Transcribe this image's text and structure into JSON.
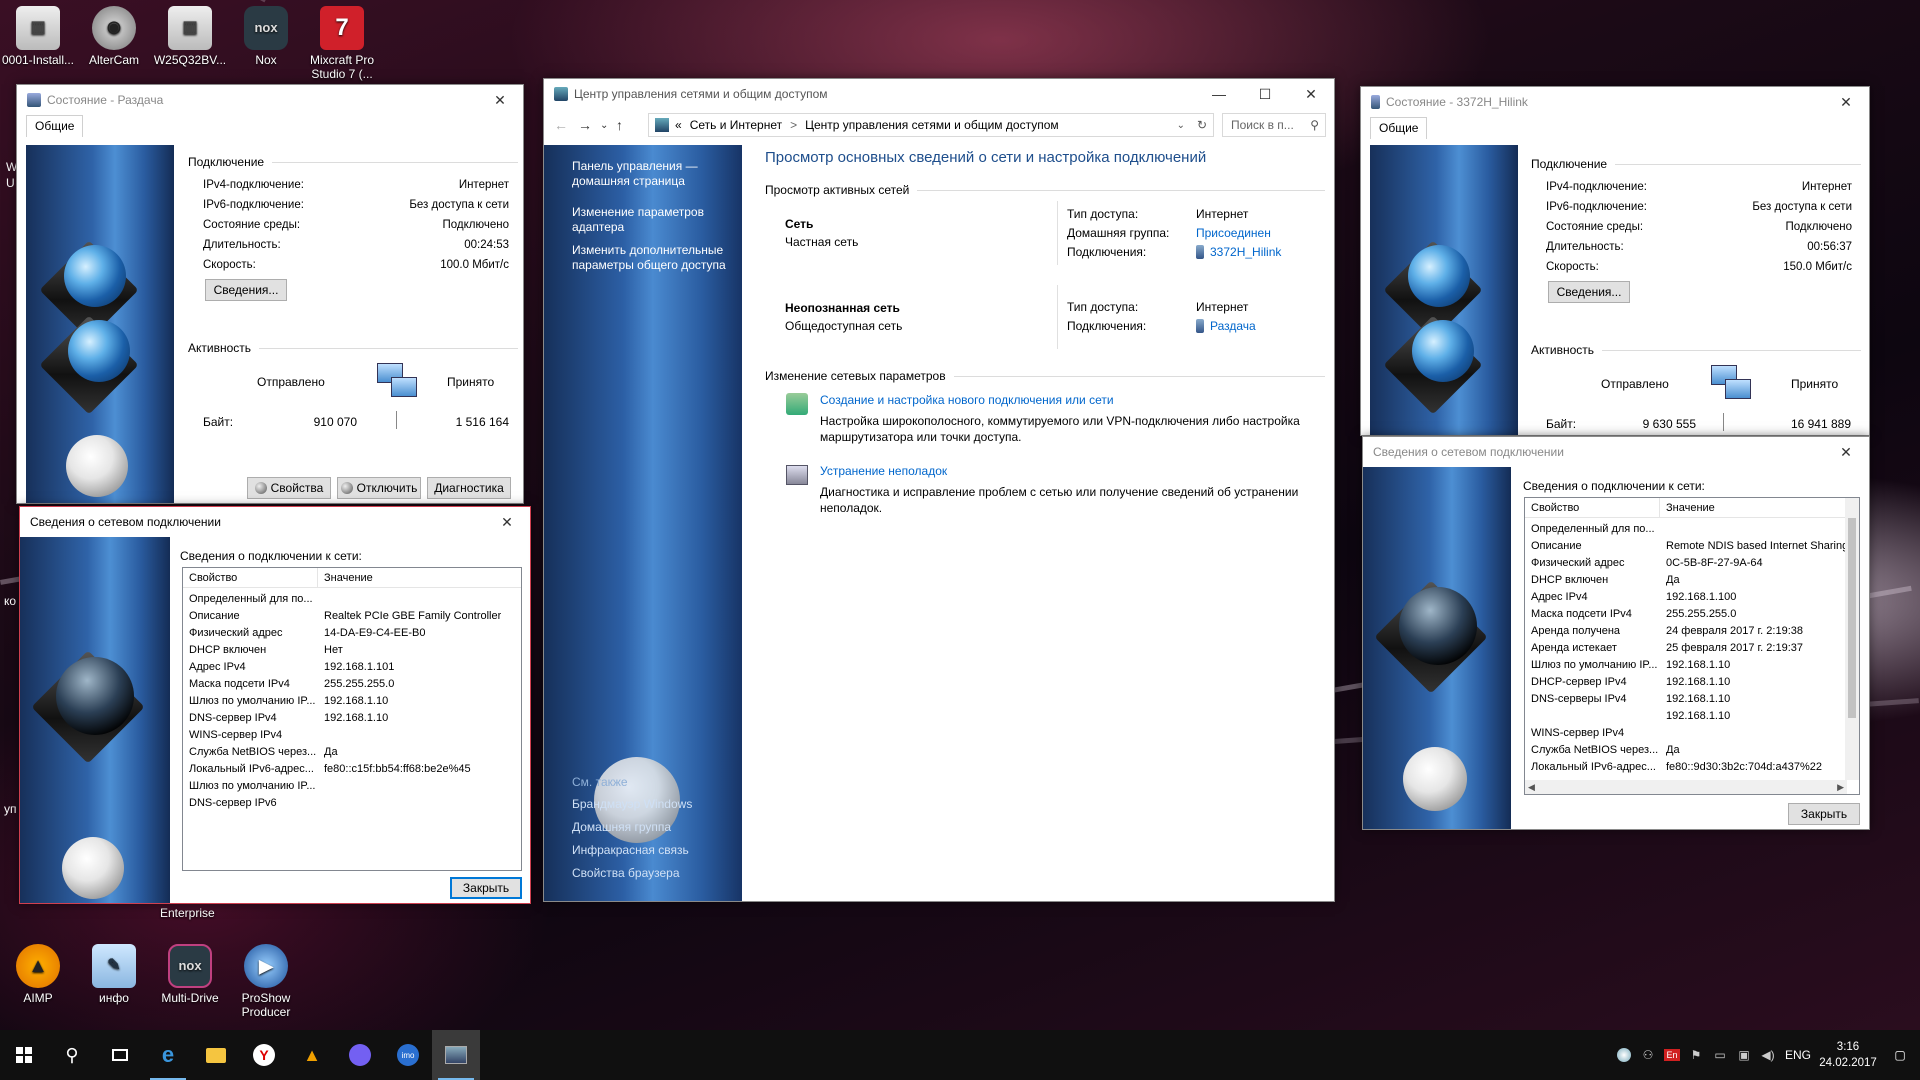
{
  "desktop": {
    "icons_top": [
      {
        "label": "0001-Install...",
        "icon": "archive-icon"
      },
      {
        "label": "AlterCam",
        "icon": "webcam-icon"
      },
      {
        "label": "W25Q32BV...",
        "icon": "archive-icon"
      },
      {
        "label": "Nox",
        "icon": "nox-icon"
      },
      {
        "label": "Mixcraft Pro Studio 7 (...",
        "icon": "mixcraft-icon"
      }
    ],
    "icons_bottom": [
      {
        "label": "AIMP",
        "icon": "aimp-icon"
      },
      {
        "label": "инфо",
        "icon": "notepad-icon"
      },
      {
        "label": "Multi-Drive",
        "icon": "nox-icon"
      },
      {
        "label": "ProShow Producer",
        "icon": "proshow-icon"
      }
    ],
    "enterprise_label": "Enterprise",
    "left_edge_fragments": [
      "W",
      "U",
      "ко",
      "уп"
    ]
  },
  "status_left": {
    "title": "Состояние - Раздача",
    "tab": "Общие",
    "section_connection": "Подключение",
    "rows": [
      {
        "k": "IPv4-подключение:",
        "v": "Интернет"
      },
      {
        "k": "IPv6-подключение:",
        "v": "Без доступа к сети"
      },
      {
        "k": "Состояние среды:",
        "v": "Подключено"
      },
      {
        "k": "Длительность:",
        "v": "00:24:53"
      },
      {
        "k": "Скорость:",
        "v": "100.0 Мбит/с"
      }
    ],
    "details_button": "Сведения...",
    "section_activity": "Активность",
    "sent": "Отправлено",
    "received": "Принято",
    "bytes_label": "Байт:",
    "bytes_sent": "910 070",
    "bytes_received": "1 516 164",
    "buttons": {
      "properties": "Свойства",
      "disable": "Отключить",
      "diagnose": "Диагностика"
    }
  },
  "details_left": {
    "title": "Сведения о сетевом подключении",
    "caption": "Сведения о подключении к сети:",
    "col_property": "Свойство",
    "col_value": "Значение",
    "rows": [
      [
        "Определенный для по...",
        ""
      ],
      [
        "Описание",
        "Realtek PCIe GBE Family Controller"
      ],
      [
        "Физический адрес",
        "14-DA-E9-C4-EE-B0"
      ],
      [
        "DHCP включен",
        "Нет"
      ],
      [
        "Адрес IPv4",
        "192.168.1.101"
      ],
      [
        "Маска подсети IPv4",
        "255.255.255.0"
      ],
      [
        "Шлюз по умолчанию IP...",
        "192.168.1.10"
      ],
      [
        "DNS-сервер IPv4",
        "192.168.1.10"
      ],
      [
        "WINS-сервер IPv4",
        ""
      ],
      [
        "Служба NetBIOS через...",
        "Да"
      ],
      [
        "Локальный IPv6-адрес...",
        "fe80::c15f:bb54:ff68:be2e%45"
      ],
      [
        "Шлюз по умолчанию IP...",
        ""
      ],
      [
        "DNS-сервер IPv6",
        ""
      ]
    ],
    "close_button": "Закрыть"
  },
  "network_center": {
    "title": "Центр управления сетями и общим доступом",
    "breadcrumb": [
      "«",
      "Сеть и Интернет",
      ">",
      "Центр управления сетями и общим доступом"
    ],
    "search_placeholder": "Поиск в п...",
    "sidebar_links": [
      "Панель управления — домашняя страница",
      "Изменение параметров адаптера",
      "Изменить дополнительные параметры общего доступа"
    ],
    "see_also_label": "См. также",
    "see_also": [
      "Брандмауэр Windows",
      "Домашняя группа",
      "Инфракрасная связь",
      "Свойства браузера"
    ],
    "heading": "Просмотр основных сведений о сети и настройка подключений",
    "active_networks_label": "Просмотр активных сетей",
    "networks": [
      {
        "name": "Сеть",
        "type": "Частная сеть",
        "access_label": "Тип доступа:",
        "access": "Интернет",
        "homegroup_label": "Домашняя группа:",
        "homegroup": "Присоединен",
        "conn_label": "Подключения:",
        "conn": "3372H_Hilink"
      },
      {
        "name": "Неопознанная сеть",
        "type": "Общедоступная сеть",
        "access_label": "Тип доступа:",
        "access": "Интернет",
        "conn_label": "Подключения:",
        "conn": "Раздача"
      }
    ],
    "change_label": "Изменение сетевых параметров",
    "tasks": [
      {
        "link": "Создание и настройка нового подключения или сети",
        "desc": "Настройка широкополосного, коммутируемого или VPN-подключения либо настройка маршрутизатора или точки доступа."
      },
      {
        "link": "Устранение неполадок",
        "desc": "Диагностика и исправление проблем с сетью или получение сведений об устранении неполадок."
      }
    ]
  },
  "status_right": {
    "title": "Состояние - 3372H_Hilink",
    "tab": "Общие",
    "section_connection": "Подключение",
    "rows": [
      {
        "k": "IPv4-подключение:",
        "v": "Интернет"
      },
      {
        "k": "IPv6-подключение:",
        "v": "Без доступа к сети"
      },
      {
        "k": "Состояние среды:",
        "v": "Подключено"
      },
      {
        "k": "Длительность:",
        "v": "00:56:37"
      },
      {
        "k": "Скорость:",
        "v": "150.0 Мбит/с"
      }
    ],
    "details_button": "Сведения...",
    "section_activity": "Активность",
    "sent": "Отправлено",
    "received": "Принято",
    "bytes_label": "Байт:",
    "bytes_sent": "9 630 555",
    "bytes_received": "16 941 889"
  },
  "details_right": {
    "title": "Сведения о сетевом подключении",
    "caption": "Сведения о подключении к сети:",
    "col_property": "Свойство",
    "col_value": "Значение",
    "rows": [
      [
        "Определенный для по...",
        ""
      ],
      [
        "Описание",
        "Remote NDIS based Internet Sharing"
      ],
      [
        "Физический адрес",
        "0C-5B-8F-27-9A-64"
      ],
      [
        "DHCP включен",
        "Да"
      ],
      [
        "Адрес IPv4",
        "192.168.1.100"
      ],
      [
        "Маска подсети IPv4",
        "255.255.255.0"
      ],
      [
        "Аренда получена",
        "24 февраля 2017 г. 2:19:38"
      ],
      [
        "Аренда истекает",
        "25 февраля 2017 г. 2:19:37"
      ],
      [
        "Шлюз по умолчанию IP...",
        "192.168.1.10"
      ],
      [
        "DHCP-сервер IPv4",
        "192.168.1.10"
      ],
      [
        "DNS-серверы IPv4",
        "192.168.1.10"
      ],
      [
        "",
        "192.168.1.10"
      ],
      [
        "WINS-сервер IPv4",
        ""
      ],
      [
        "Служба NetBIOS через...",
        "Да"
      ],
      [
        "Локальный IPv6-адрес...",
        "fe80::9d30:3b2c:704d:a437%22"
      ]
    ],
    "close_button": "Закрыть"
  },
  "taskbar": {
    "language": "ENG",
    "tray_lang_badge": "En",
    "time": "3:16",
    "date": "24.02.2017",
    "imo_label": "imo"
  },
  "colors": {
    "link": "#0066cc",
    "heading": "#1e4e8c",
    "taskbar": "#101010",
    "active_border": "#d04050"
  }
}
